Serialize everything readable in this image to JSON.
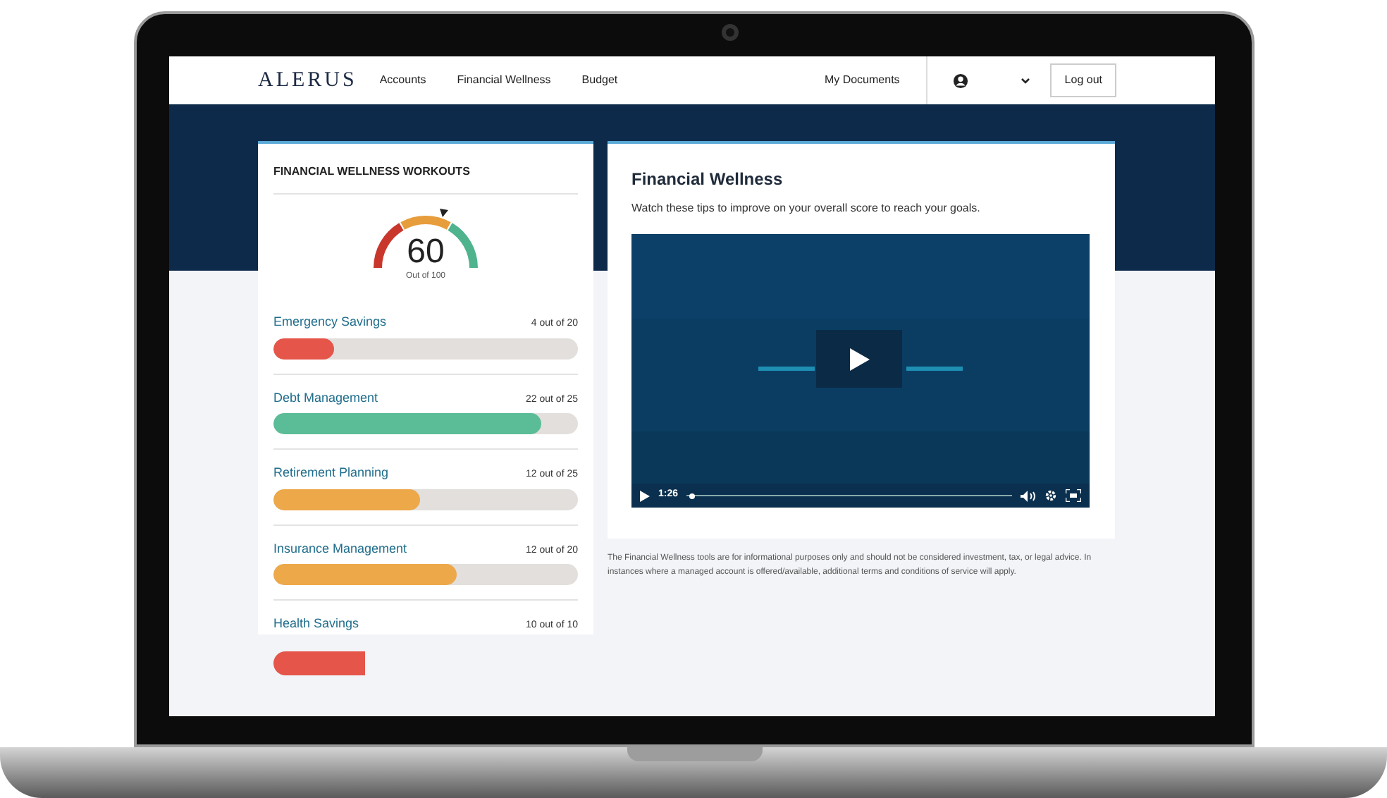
{
  "nav": {
    "logo": "ALERUS",
    "links": [
      "Accounts",
      "Financial Wellness",
      "Budget"
    ],
    "documents": "My Documents",
    "logout": "Log out"
  },
  "workouts": {
    "title": "FINANCIAL WELLNESS WORKOUTS",
    "gauge": {
      "score": "60",
      "caption": "Out of 100"
    },
    "items": [
      {
        "name": "Emergency Savings",
        "score": "4 out of 20",
        "level": 0.2,
        "color": "#e5554a",
        "kind": "bar"
      },
      {
        "name": "Debt Management",
        "score": "22 out of 25",
        "level": 0.88,
        "color": "#5bbd97",
        "kind": "bar"
      },
      {
        "name": "Retirement Planning",
        "score": "12 out of 25",
        "level": 0.48,
        "color": "#eda84a",
        "kind": "bar"
      },
      {
        "name": "Insurance Management",
        "score": "12 out of 20",
        "level": 0.6,
        "color": "#eda84a",
        "kind": "bar"
      },
      {
        "name": "Health Savings",
        "score": "10 out of 10",
        "color": "#e5554a",
        "kind": "detached"
      }
    ]
  },
  "video_card": {
    "title": "Financial Wellness",
    "subtitle": "Watch these tips to improve on your overall score to reach your goals.",
    "time": "1:26",
    "progress": {
      "level": 0.01
    }
  },
  "disclaimer": "The Financial Wellness tools are for informational purposes only and should not be considered investment, tax, or legal advice. In instances where a managed account is offered/available, additional terms and conditions of service will apply."
}
